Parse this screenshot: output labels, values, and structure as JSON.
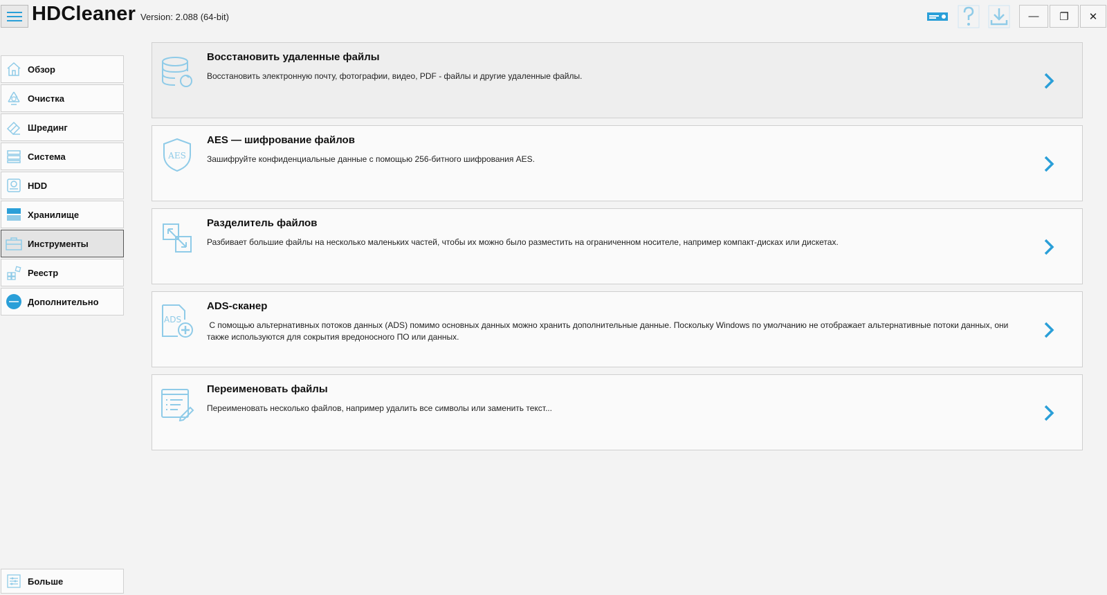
{
  "app": {
    "title": "HDCleaner",
    "version": "Version: 2.088 (64-bit)"
  },
  "colors": {
    "accent": "#2a9fd8",
    "icon_light": "#8fcbe8",
    "background": "#f3f3f3"
  },
  "titlebar": {
    "icons": [
      "badge-icon",
      "help-icon",
      "download-icon"
    ],
    "window_buttons": {
      "minimize": "—",
      "restore": "❐",
      "close": "✕"
    }
  },
  "sidebar": {
    "items": [
      {
        "label": "Обзор",
        "icon": "home-icon",
        "active": false
      },
      {
        "label": "Очистка",
        "icon": "recycle-icon",
        "active": false
      },
      {
        "label": "Шрединг",
        "icon": "eraser-icon",
        "active": false
      },
      {
        "label": "Система",
        "icon": "system-icon",
        "active": false
      },
      {
        "label": "HDD",
        "icon": "hdd-icon",
        "active": false
      },
      {
        "label": "Хранилище",
        "icon": "storage-icon",
        "active": false
      },
      {
        "label": "Инструменты",
        "icon": "toolbox-icon",
        "active": true
      },
      {
        "label": "Реестр",
        "icon": "registry-icon",
        "active": false
      },
      {
        "label": "Дополнительно",
        "icon": "extras-icon",
        "active": false
      }
    ],
    "more_label": "Больше"
  },
  "tools": [
    {
      "title": "Восстановить удаленные файлы",
      "description": "Восстановить электронную почту, фотографии, видео, PDF - файлы и другие удаленные файлы.",
      "icon": "database-restore-icon"
    },
    {
      "title": "AES — шифрование файлов",
      "description": "Зашифруйте конфиденциальные данные с помощью 256-битного шифрования AES.",
      "icon": "aes-shield-icon",
      "icon_text": "AES"
    },
    {
      "title": "Разделитель файлов",
      "description": "Разбивает большие файлы на несколько маленьких частей, чтобы их можно было разместить на ограниченном носителе, например компакт-дисках или дискетах.",
      "icon": "file-split-icon"
    },
    {
      "title": "ADS-сканер",
      "description": " С помощью альтернативных потоков данных (ADS) помимо основных данных можно хранить дополнительные данные. Поскольку Windows по умолчанию не отображает альтернативные потоки данных, они также используются для сокрытия вредоносного ПО или данных.",
      "icon": "ads-file-icon",
      "icon_text": "ADS"
    },
    {
      "title": "Переименовать файлы",
      "description": "Переименовать несколько файлов, например удалить все символы или заменить текст...",
      "icon": "rename-list-icon"
    }
  ]
}
